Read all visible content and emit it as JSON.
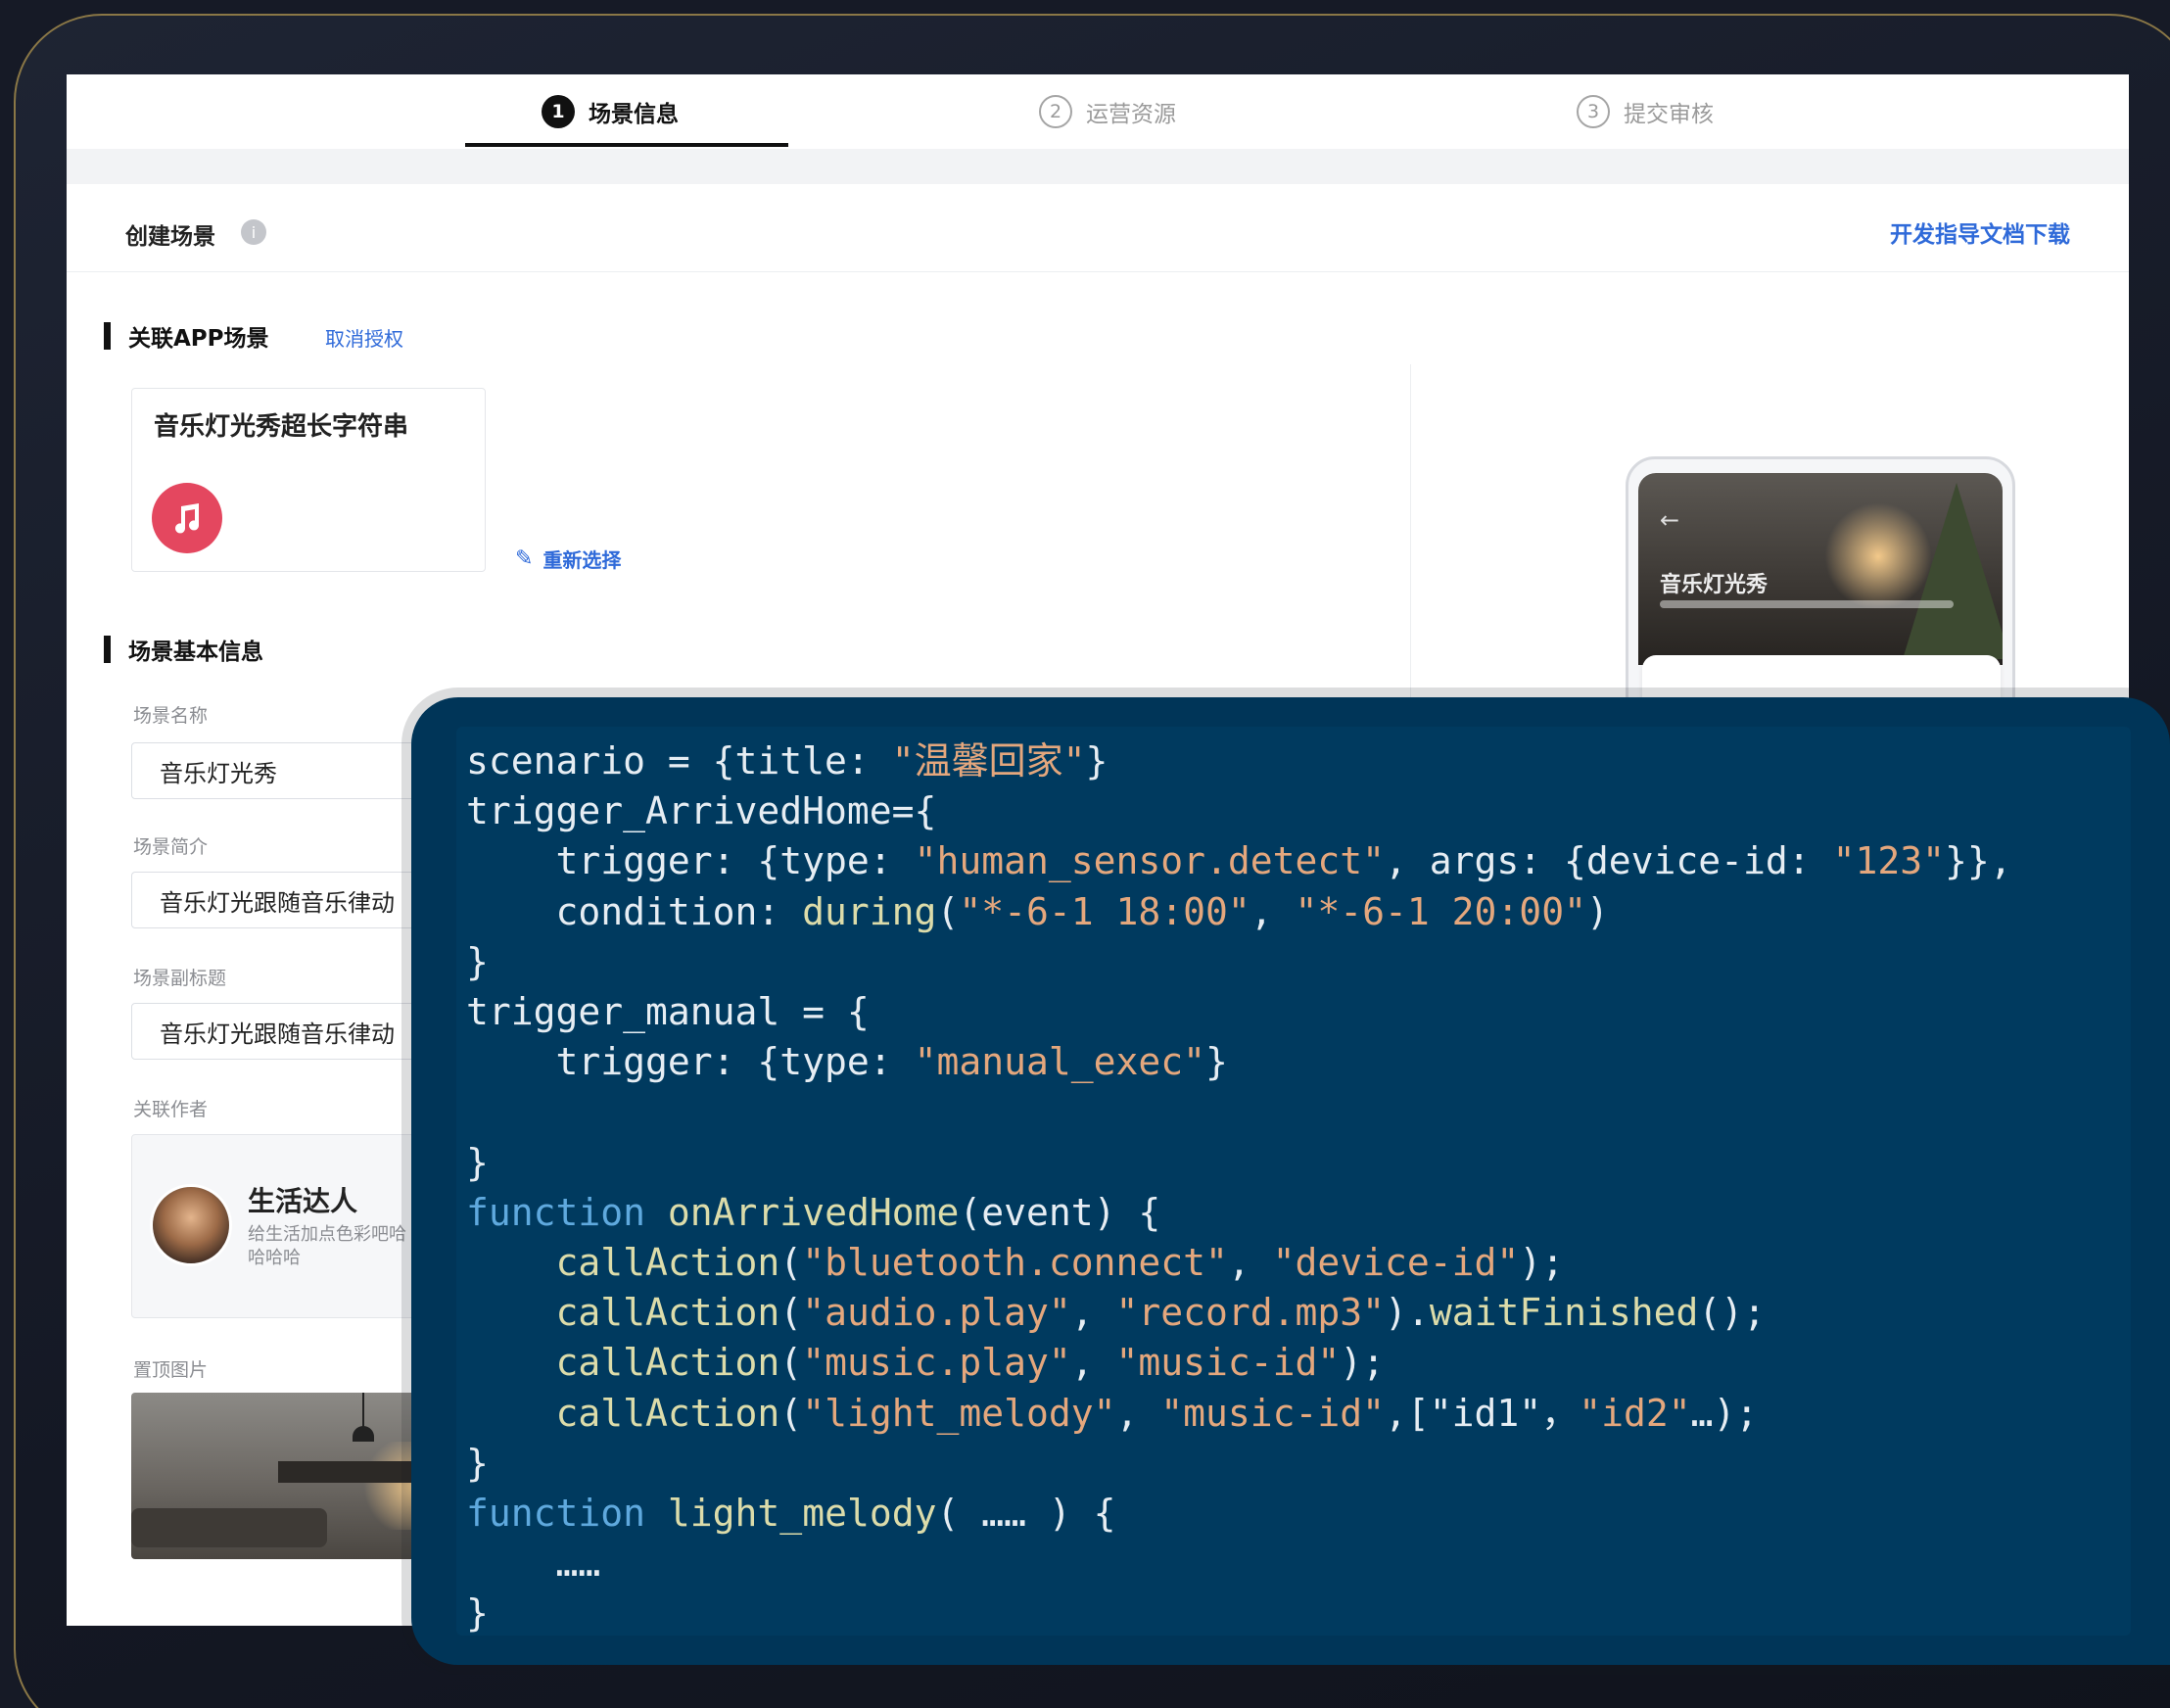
{
  "steps": [
    {
      "num": "1",
      "label": "场景信息",
      "active": true
    },
    {
      "num": "2",
      "label": "运营资源",
      "active": false
    },
    {
      "num": "3",
      "label": "提交审核",
      "active": false
    }
  ],
  "header": {
    "title": "创建场景",
    "info_icon": "i",
    "doc_link": "开发指导文档下载"
  },
  "app_section": {
    "title": "关联APP场景",
    "cancel_link": "取消授权",
    "app_name": "音乐灯光秀超长字符串",
    "reselect": "重新选择"
  },
  "basic_section": {
    "title": "场景基本信息",
    "name_label": "场景名称",
    "name_value": "音乐灯光秀",
    "intro_label": "场景简介",
    "intro_value": "音乐灯光跟随音乐律动",
    "subtitle_label": "场景副标题",
    "subtitle_value": "音乐灯光跟随音乐律动",
    "author_label": "关联作者",
    "author_name": "生活达人",
    "author_desc": "给生活加点色彩吧哈哈哈哈",
    "banner_label": "置顶图片"
  },
  "preview": {
    "title": "音乐灯光秀",
    "back": "←"
  },
  "code": [
    [
      [
        "t",
        "scenario = {title: "
      ],
      [
        "str",
        "\"温馨回家\""
      ],
      [
        "t",
        "}"
      ]
    ],
    [
      [
        "t",
        "trigger_ArrivedHome={"
      ]
    ],
    [
      [
        "t",
        "    trigger: {type: "
      ],
      [
        "str",
        "\"human_sensor.detect\""
      ],
      [
        "t",
        ", args: {device-id: "
      ],
      [
        "str",
        "\"123\""
      ],
      [
        "t",
        "}},"
      ]
    ],
    [
      [
        "t",
        "    condition: "
      ],
      [
        "fn",
        "during"
      ],
      [
        "t",
        "("
      ],
      [
        "str",
        "\"*-6-1 18:00\""
      ],
      [
        "t",
        ", "
      ],
      [
        "str",
        "\"*-6-1 20:00\""
      ],
      [
        "t",
        ")"
      ]
    ],
    [
      [
        "t",
        "}"
      ]
    ],
    [
      [
        "t",
        "trigger_manual = {"
      ]
    ],
    [
      [
        "t",
        "    trigger: {type: "
      ],
      [
        "str",
        "\"manual_exec\""
      ],
      [
        "t",
        "}"
      ]
    ],
    [
      [
        "t",
        ""
      ]
    ],
    [
      [
        "t",
        "}"
      ]
    ],
    [
      [
        "kw",
        "function"
      ],
      [
        "t",
        " "
      ],
      [
        "fn",
        "onArrivedHome"
      ],
      [
        "t",
        "(event) {"
      ]
    ],
    [
      [
        "t",
        "    "
      ],
      [
        "fn",
        "callAction"
      ],
      [
        "t",
        "("
      ],
      [
        "str",
        "\"bluetooth.connect\""
      ],
      [
        "t",
        ", "
      ],
      [
        "str",
        "\"device-id\""
      ],
      [
        "t",
        ");"
      ]
    ],
    [
      [
        "t",
        "    "
      ],
      [
        "fn",
        "callAction"
      ],
      [
        "t",
        "("
      ],
      [
        "str",
        "\"audio.play\""
      ],
      [
        "t",
        ", "
      ],
      [
        "str",
        "\"record.mp3\""
      ],
      [
        "t",
        ")."
      ],
      [
        "fn",
        "waitFinished"
      ],
      [
        "t",
        "();"
      ]
    ],
    [
      [
        "t",
        "    "
      ],
      [
        "fn",
        "callAction"
      ],
      [
        "t",
        "("
      ],
      [
        "str",
        "\"music.play\""
      ],
      [
        "t",
        ", "
      ],
      [
        "str",
        "\"music-id\""
      ],
      [
        "t",
        ");"
      ]
    ],
    [
      [
        "t",
        "    "
      ],
      [
        "fn",
        "callAction"
      ],
      [
        "t",
        "("
      ],
      [
        "str",
        "\"light_melody\""
      ],
      [
        "t",
        ", "
      ],
      [
        "str",
        "\"music-id\""
      ],
      [
        "t",
        ",[\"id1\"，"
      ],
      [
        "str",
        "\"id2\""
      ],
      [
        "t",
        "…);"
      ]
    ],
    [
      [
        "t",
        "}"
      ]
    ],
    [
      [
        "kw",
        "function"
      ],
      [
        "t",
        " "
      ],
      [
        "fn",
        "light_melody"
      ],
      [
        "t",
        "( …… ) {"
      ]
    ],
    [
      [
        "t",
        "    ……"
      ]
    ],
    [
      [
        "t",
        "}"
      ]
    ]
  ],
  "colors": {
    "accent": "#2f6ad9",
    "code_bg": "#003a5f",
    "keyword": "#5fa9de",
    "function": "#dcdcaa",
    "string": "#e4a77d",
    "frame_border": "#8a7746"
  }
}
